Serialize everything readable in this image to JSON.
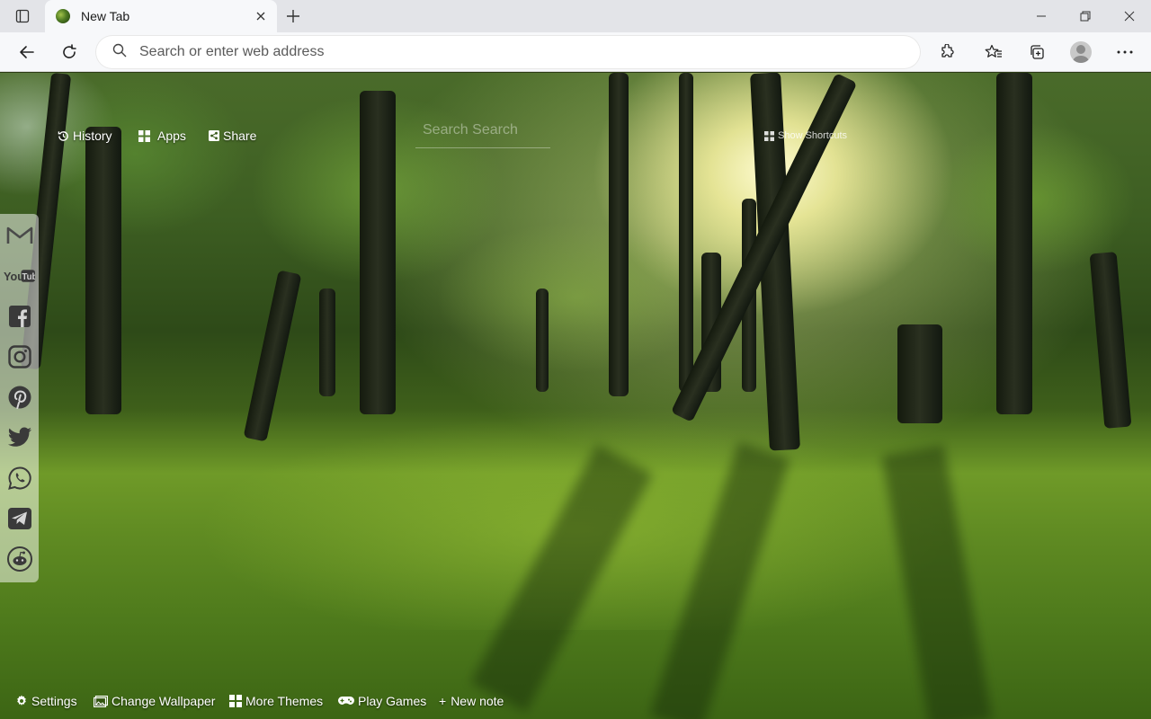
{
  "tab": {
    "title": "New Tab"
  },
  "toolbar": {
    "search_placeholder": "Search or enter web address"
  },
  "links": {
    "history": "History",
    "apps": "Apps",
    "share": "Share"
  },
  "page_search": {
    "placeholder": "Search Search"
  },
  "shortcuts": {
    "label": "Show Shortcuts"
  },
  "social": [
    "gmail-icon",
    "youtube-icon",
    "facebook-icon",
    "instagram-icon",
    "pinterest-icon",
    "twitter-icon",
    "whatsapp-icon",
    "telegram-icon",
    "reddit-icon"
  ],
  "footer": {
    "settings": "Settings",
    "change_wallpaper": "Change Wallpaper",
    "more_themes": "More Themes",
    "play_games": "Play Games",
    "new_note": "New note"
  },
  "colors": {
    "chrome_bg": "#e3e4e8",
    "toolbar_bg": "#f7f8fa",
    "text_white": "#ffffff"
  }
}
